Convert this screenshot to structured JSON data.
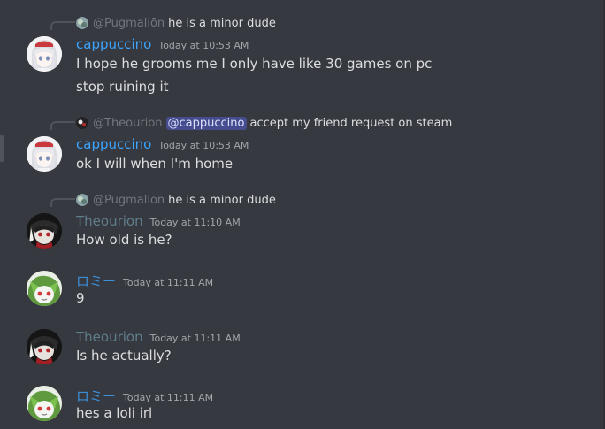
{
  "colors": {
    "background": "#36393f",
    "cappuccino_name": "#3ba5ff",
    "theourion_name": "#607d8b",
    "romi_name": "#3b8fd9",
    "message_text": "#dcddde",
    "timestamp": "#a3a6aa",
    "mention_bg": "#5865f2"
  },
  "messages": [
    {
      "reply": {
        "avatar_icon": "pugmalion-avatar-icon",
        "author": "@Pugmaliōn",
        "text": "he is a minor dude"
      },
      "author": "cappuccino",
      "timestamp": "Today at 10:53 AM",
      "lines": [
        "I hope he grooms me I only have like 30 games on pc",
        "stop ruining it"
      ]
    },
    {
      "reply": {
        "avatar_icon": "theourion-avatar-icon",
        "author": "@Theourion",
        "mention": "@cappuccino",
        "text": "accept my friend request on steam"
      },
      "author": "cappuccino",
      "timestamp": "Today at 10:53 AM",
      "lines": [
        "ok I will when I'm home"
      ]
    },
    {
      "reply": {
        "avatar_icon": "pugmalion-avatar-icon",
        "author": "@Pugmaliōn",
        "text": "he is a minor dude"
      },
      "author": "Theourion",
      "timestamp": "Today at 11:10 AM",
      "lines": [
        "How old is he?"
      ]
    },
    {
      "author": "ロミー",
      "timestamp": "Today at 11:11 AM",
      "lines": [
        "9"
      ]
    },
    {
      "author": "Theourion",
      "timestamp": "Today at 11:11 AM",
      "lines": [
        "Is he actually?"
      ]
    },
    {
      "author": "ロミー",
      "timestamp": "Today at 11:11 AM",
      "lines": [
        "hes a loli irl"
      ]
    }
  ]
}
